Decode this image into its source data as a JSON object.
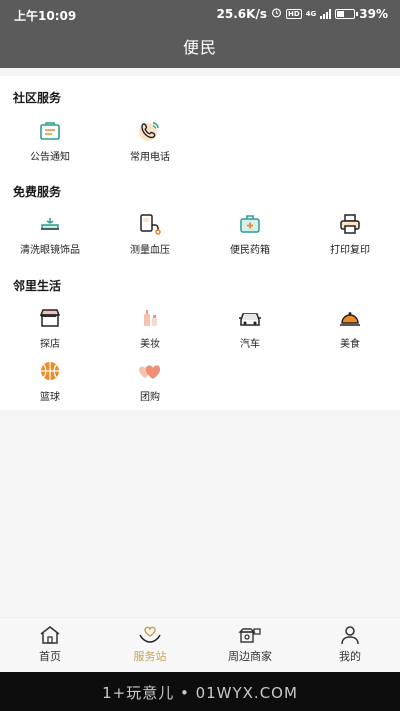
{
  "status": {
    "time": "上午10:09",
    "speed": "25.6K/s",
    "hd": "HD",
    "net": "4G",
    "battery": "39%"
  },
  "header": {
    "title": "便民"
  },
  "sections": [
    {
      "title": "社区服务",
      "items": [
        {
          "label": "公告通知",
          "icon": "notice-icon"
        },
        {
          "label": "常用电话",
          "icon": "phone-icon"
        }
      ]
    },
    {
      "title": "免费服务",
      "items": [
        {
          "label": "清洗眼镜饰品",
          "icon": "glasses-clean-icon"
        },
        {
          "label": "测量血压",
          "icon": "blood-pressure-icon"
        },
        {
          "label": "便民药箱",
          "icon": "medicine-box-icon"
        },
        {
          "label": "打印复印",
          "icon": "printer-icon"
        }
      ]
    },
    {
      "title": "邻里生活",
      "items": [
        {
          "label": "探店",
          "icon": "shop-icon"
        },
        {
          "label": "美妆",
          "icon": "cosmetics-icon"
        },
        {
          "label": "汽车",
          "icon": "car-icon"
        },
        {
          "label": "美食",
          "icon": "food-icon"
        },
        {
          "label": "篮球",
          "icon": "basketball-icon"
        },
        {
          "label": "团购",
          "icon": "group-buy-icon"
        }
      ]
    }
  ],
  "nav": [
    {
      "label": "首页",
      "icon": "home-icon",
      "active": false
    },
    {
      "label": "服务站",
      "icon": "heart-hand-icon",
      "active": true
    },
    {
      "label": "周边商家",
      "icon": "merchants-icon",
      "active": false
    },
    {
      "label": "我的",
      "icon": "profile-icon",
      "active": false
    }
  ],
  "watermark": "1+玩意儿 • 01WYX.COM",
  "colors": {
    "accent": "#c8a256",
    "topbar": "#5b5b5b",
    "icon_teal": "#2a9d8f",
    "icon_orange": "#f08a24"
  }
}
